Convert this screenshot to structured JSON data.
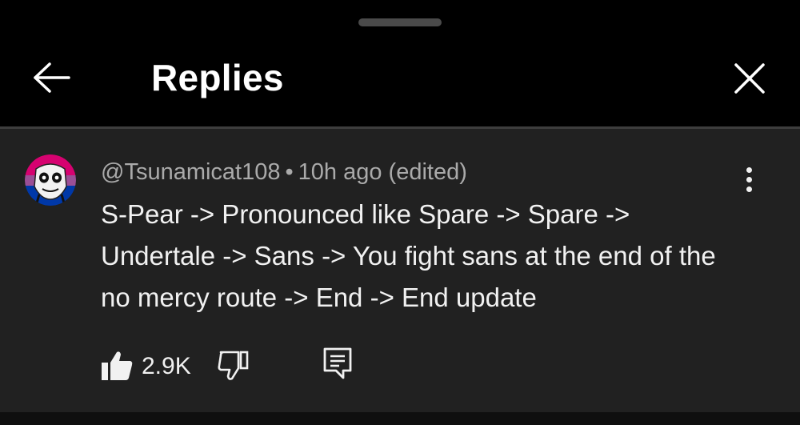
{
  "header": {
    "title": "Replies",
    "back_icon": "arrow-left-icon",
    "close_icon": "close-icon"
  },
  "comment": {
    "author": "@Tsunamicat108",
    "separator": "•",
    "time": "10h ago",
    "edited": "(edited)",
    "text": "S-Pear -> Pronounced like Spare -> Spare -> Undertale -> Sans -> You fight sans at the end of the no mercy route -> End -> End update",
    "like_count": "2.9K",
    "actions": {
      "like_icon": "thumbs-up-filled-icon",
      "dislike_icon": "thumbs-down-outline-icon",
      "reply_icon": "reply-comment-icon",
      "more_icon": "more-vertical-icon"
    }
  },
  "colors": {
    "header_bg": "#000000",
    "content_bg": "#212121",
    "text_primary": "#f1f1f1",
    "text_secondary": "#aaaaaa",
    "avatar_flag": [
      "#d60270",
      "#9b4f96",
      "#0038a8"
    ]
  }
}
